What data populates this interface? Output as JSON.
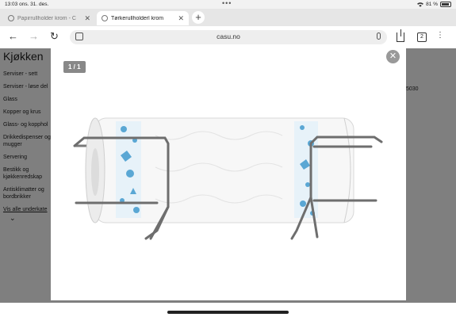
{
  "status": {
    "time": "13:03",
    "date": "ons. 31. des.",
    "battery": "81 %"
  },
  "tabs": [
    {
      "title": "Papirrullholder krom - C",
      "active": false
    },
    {
      "title": "Tørkerullholderl krom",
      "active": true
    }
  ],
  "toolbar": {
    "url": "casu.no",
    "tab_count": "2"
  },
  "page": {
    "heading": "Kjøkken",
    "categories": [
      "Serviser - sett",
      "Serviser - løse del",
      "Glass",
      "Kopper og krus",
      "Glass- og kopphol",
      "Drikkedispenser og mugger",
      "Servering",
      "Bestikk og kjøkkenredskap",
      "Antisklimatter og bordbrikker"
    ],
    "show_all": "Vis alle underkate",
    "sku_fragment": "5030"
  },
  "lightbox": {
    "counter": "1 / 1",
    "close_symbol": "✕",
    "image_alt_icon": "paper-towel-holder-image"
  },
  "colors": {
    "overlay": "#000000",
    "accent_blue": "#5aa7d4"
  }
}
